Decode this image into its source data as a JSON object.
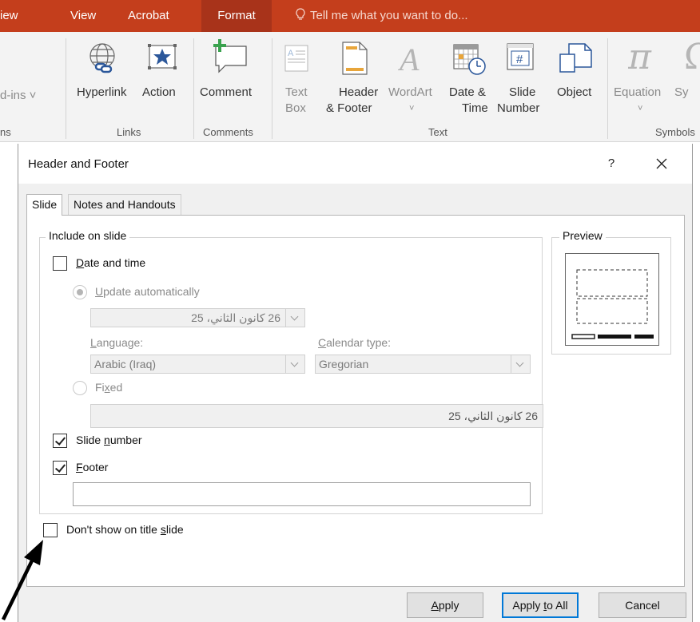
{
  "ribbon": {
    "tabs": [
      "iew",
      "View",
      "Acrobat",
      "Format"
    ],
    "tell_me": "Tell me what you want to do...",
    "buttons": {
      "addins": "d-ins",
      "hyperlink": "Hyperlink",
      "action": "Action",
      "comment": "Comment",
      "textbox_1": "Text",
      "textbox_2": "Box",
      "header_1": "Header",
      "header_2": "& Footer",
      "wordart": "WordArt",
      "datetime_1": "Date &",
      "datetime_2": "Time",
      "slidenum_1": "Slide",
      "slidenum_2": "Number",
      "object": "Object",
      "equation": "Equation",
      "symbol": "Sy"
    },
    "groups": {
      "addins": "ns",
      "links": "Links",
      "comments": "Comments",
      "text": "Text",
      "symbols": "Symbols"
    },
    "colors": {
      "tab_bar": "#c43e1c",
      "active_tab": "#a8331a"
    }
  },
  "dialog": {
    "title": "Header and Footer",
    "help": "?",
    "tabs": [
      "Slide",
      "Notes and Handouts"
    ],
    "include_legend": "Include on slide",
    "preview_legend": "Preview",
    "date_time": {
      "label_u": "D",
      "label_rest": "ate and time",
      "checked": false
    },
    "update_auto": {
      "label_u": "U",
      "label_rest": "pdate automatically",
      "selected": true,
      "enabled": false
    },
    "date_value": "26 كانون الثاني، 25",
    "language": {
      "label_u": "L",
      "label_rest": "anguage:",
      "value": "Arabic (Iraq)"
    },
    "calendar": {
      "label_u": "C",
      "label_rest": "alendar type:",
      "value": "Gregorian"
    },
    "fixed": {
      "label_a": "Fi",
      "label_u": "x",
      "label_b": "ed",
      "selected": false,
      "value": "26 كانون الثاني، 25"
    },
    "slide_number": {
      "label_a": "Slide ",
      "label_u": "n",
      "label_b": "umber",
      "checked": true
    },
    "footer": {
      "label_u": "F",
      "label_rest": "ooter",
      "checked": true,
      "value": ""
    },
    "dont_show": {
      "label_a": "Don't show on title ",
      "label_u": "s",
      "label_b": "lide",
      "checked": false
    },
    "buttons": {
      "apply_u": "A",
      "apply_rest": "pply",
      "apply_all_a": "Apply ",
      "apply_all_u": "t",
      "apply_all_b": "o All",
      "cancel": "Cancel"
    },
    "colors": {
      "default_button_border": "#0078d7"
    }
  }
}
